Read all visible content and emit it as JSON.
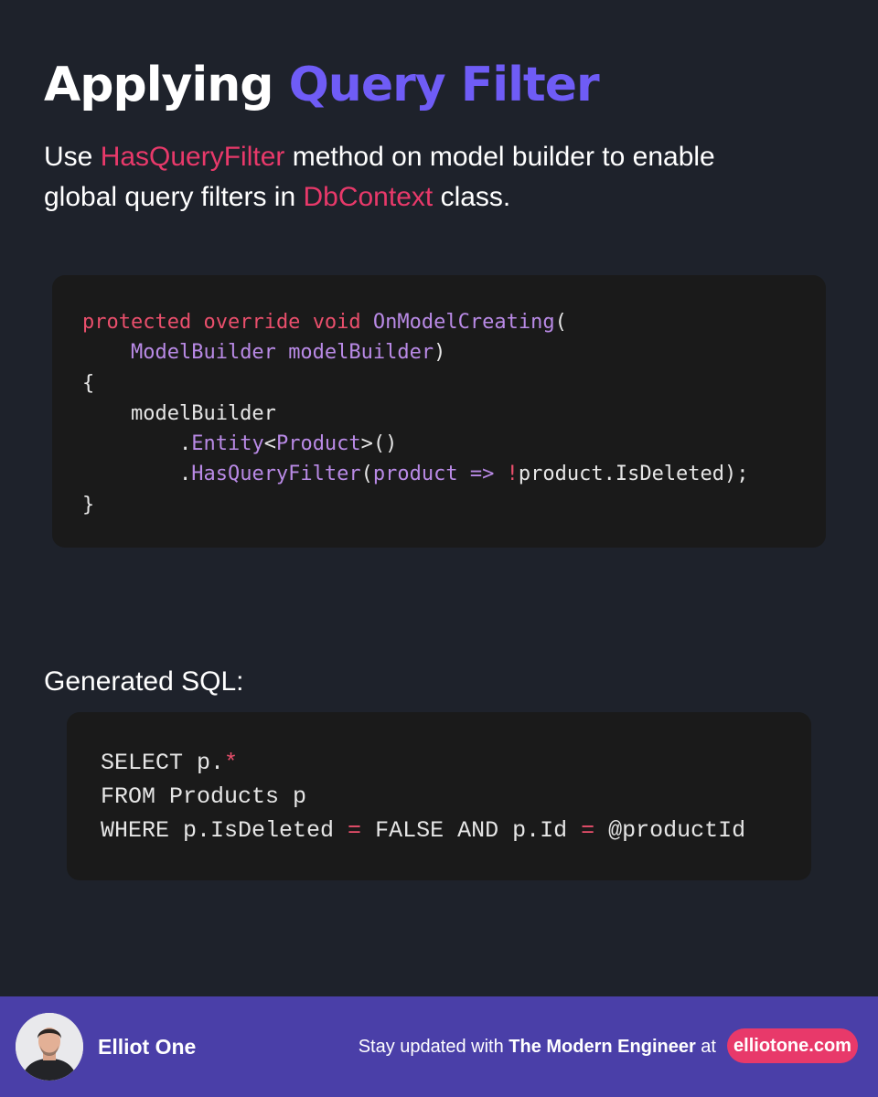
{
  "header": {
    "title_plain": "Applying",
    "title_accent": "Query Filter"
  },
  "intro": {
    "part1": "Use ",
    "method": "HasQueryFilter",
    "part2": " method on model builder to enable global query filters in ",
    "class_name": "DbContext",
    "part3": " class."
  },
  "code_snippet": {
    "language": "C#",
    "lines": [
      "protected override void OnModelCreating(",
      "    ModelBuilder modelBuilder)",
      "{",
      "    modelBuilder",
      "        .Entity<Product>()",
      "        .HasQueryFilter(product => !product.IsDeleted);",
      "}"
    ]
  },
  "sql_section": {
    "label": "Generated SQL:",
    "lines": [
      "SELECT p.*",
      "FROM Products p",
      "WHERE p.IsDeleted = FALSE AND p.Id = @productId"
    ]
  },
  "footer": {
    "author": "Elliot One",
    "tagline_prefix": "Stay updated with ",
    "newsletter": "The Modern Engineer",
    "tagline_suffix": " at",
    "site": "elliotone.com"
  },
  "colors": {
    "background": "#1e222b",
    "accent_purple": "#6f5cf6",
    "highlight_pink": "#e8396a",
    "footer_bar": "#4a3fa8",
    "code_bg": "#1a1a1a"
  }
}
